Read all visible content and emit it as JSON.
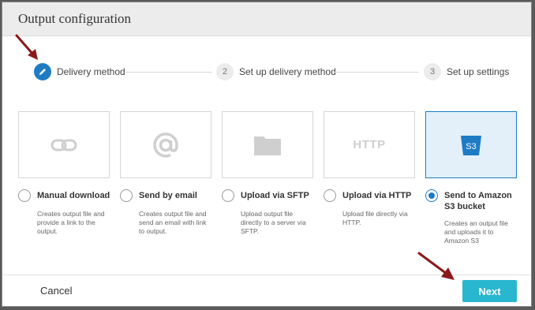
{
  "dialog": {
    "title": "Output configuration"
  },
  "stepper": {
    "steps": [
      {
        "number": "",
        "label": "Delivery method",
        "state": "active",
        "icon": "pencil-icon"
      },
      {
        "number": "2",
        "label": "Set up delivery method",
        "state": "pending"
      },
      {
        "number": "3",
        "label": "Set up settings",
        "state": "pending"
      }
    ]
  },
  "options": [
    {
      "name": "Manual download",
      "description": "Creates output file and provide a link to the output.",
      "icon": "link-icon",
      "selected": false
    },
    {
      "name": "Send by email",
      "description": "Creates output file and send an email with link to output.",
      "icon": "at-sign-icon",
      "selected": false
    },
    {
      "name": "Upload via SFTP",
      "description": "Upload output file directly to a server via SFTP.",
      "icon": "folder-icon",
      "selected": false
    },
    {
      "name": "Upload via HTTP",
      "description": "Upload file directly via HTTP.",
      "icon": "http-icon",
      "icon_text": "HTTP",
      "selected": false
    },
    {
      "name": "Send to Amazon S3 bucket",
      "description": "Creates an output file and uploads it to Amazon S3",
      "icon": "s3-bucket-icon",
      "icon_text": "S3",
      "selected": true
    }
  ],
  "footer": {
    "cancel_label": "Cancel",
    "next_label": "Next"
  },
  "colors": {
    "accent": "#1f7bc4",
    "next_button": "#29b6cf",
    "annotation_arrow": "#8b1a1a"
  }
}
